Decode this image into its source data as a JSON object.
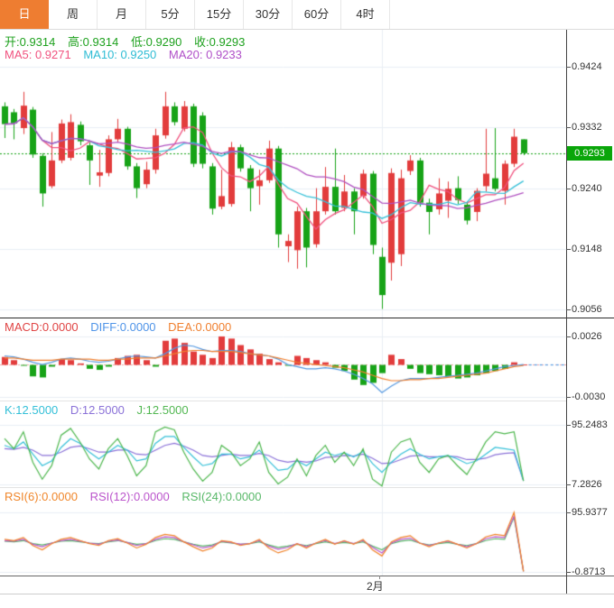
{
  "tabbar": {
    "tabs": [
      {
        "label": "日",
        "selected": true
      },
      {
        "label": "周",
        "selected": false
      },
      {
        "label": "月",
        "selected": false
      },
      {
        "label": "5分",
        "selected": false
      },
      {
        "label": "15分",
        "selected": false
      },
      {
        "label": "30分",
        "selected": false
      },
      {
        "label": "60分",
        "selected": false
      },
      {
        "label": "4时",
        "selected": false
      }
    ]
  },
  "main_panel": {
    "ohlc": {
      "open": "开:0.9314",
      "high": "高:0.9314",
      "low": "低:0.9290",
      "close": "收:0.9293"
    },
    "ma": {
      "ma5": "MA5: 0.9271",
      "ma10": "MA10: 0.9250",
      "ma20": "MA20: 0.9233"
    },
    "price_tag": "0.9293"
  },
  "macd_panel": {
    "macd": "MACD:0.0000",
    "diff": "DIFF:0.0000",
    "dea": "DEA:0.0000"
  },
  "kdj_panel": {
    "k": "K:12.5000",
    "d": "D:12.5000",
    "j": "J:12.5000"
  },
  "rsi_panel": {
    "rsi6": "RSI(6):0.0000",
    "rsi12": "RSI(12):0.0000",
    "rsi24": "RSI(24):0.0000"
  },
  "x_axis": {
    "label": "2月"
  },
  "colors": {
    "tab_selected": "#ee7d31",
    "candle_up": "#e23c3c",
    "candle_down": "#17a317",
    "price_tag": "#0aa60a",
    "grid": "#e9eef4"
  },
  "chart_data": [
    {
      "type": "candlestick",
      "title": "daily candles with MA5/MA10/MA20 overlays",
      "ylim": [
        0.9044,
        0.948
      ],
      "y_ticks": [
        {
          "v": 0.9424,
          "label": "0.9424"
        },
        {
          "v": 0.9332,
          "label": "0.9332"
        },
        {
          "v": 0.924,
          "label": "0.9240"
        },
        {
          "v": 0.9148,
          "label": "0.9148"
        },
        {
          "v": 0.9056,
          "label": "0.9056"
        }
      ],
      "last_price": 0.9293,
      "x_divider_index": 40,
      "up_color": "#e23c3c",
      "down_color": "#17a317",
      "last_price_line_color": "#12a012",
      "ma_overlays": [
        {
          "name": "MA5",
          "period": 5,
          "value": 0.9271,
          "color": "#f0527f"
        },
        {
          "name": "MA10",
          "period": 10,
          "value": 0.925,
          "color": "#35c0d8"
        },
        {
          "name": "MA20",
          "period": 20,
          "value": 0.9233,
          "color": "#b050c0"
        }
      ],
      "open": [
        0.9364,
        0.9355,
        0.9331,
        0.9359,
        0.9289,
        0.9243,
        0.9282,
        0.9286,
        0.9336,
        0.9305,
        0.9259,
        0.9263,
        0.9314,
        0.933,
        0.9273,
        0.9246,
        0.9268,
        0.932,
        0.9364,
        0.933,
        0.9364,
        0.935,
        0.9273,
        0.9212,
        0.9216,
        0.9302,
        0.927,
        0.9243,
        0.9252,
        0.93,
        0.9152,
        0.9146,
        0.9205,
        0.9155,
        0.9205,
        0.9242,
        0.921,
        0.9235,
        0.9228,
        0.9262,
        0.9136,
        0.9127,
        0.914,
        0.9266,
        0.9282,
        0.9218,
        0.9208,
        0.9221,
        0.924,
        0.9215,
        0.9204,
        0.9243,
        0.9255,
        0.9236,
        0.9277,
        0.9314
      ],
      "high": [
        0.937,
        0.936,
        0.9386,
        0.9363,
        0.9293,
        0.9325,
        0.9344,
        0.9352,
        0.9341,
        0.9309,
        0.9298,
        0.932,
        0.9345,
        0.9333,
        0.9278,
        0.928,
        0.933,
        0.9386,
        0.937,
        0.9372,
        0.9368,
        0.9355,
        0.9278,
        0.9268,
        0.931,
        0.9306,
        0.9275,
        0.9268,
        0.9312,
        0.9304,
        0.917,
        0.9212,
        0.921,
        0.924,
        0.9272,
        0.93,
        0.926,
        0.924,
        0.9268,
        0.9266,
        0.915,
        0.927,
        0.9268,
        0.929,
        0.9286,
        0.9224,
        0.9255,
        0.925,
        0.9258,
        0.922,
        0.924,
        0.933,
        0.9331,
        0.9282,
        0.933,
        0.9314
      ],
      "low": [
        0.9316,
        0.9314,
        0.9322,
        0.9286,
        0.9212,
        0.924,
        0.9278,
        0.9282,
        0.9305,
        0.9245,
        0.9242,
        0.9258,
        0.931,
        0.9268,
        0.9225,
        0.924,
        0.9262,
        0.9315,
        0.9335,
        0.9326,
        0.9272,
        0.927,
        0.92,
        0.9208,
        0.9212,
        0.9265,
        0.9205,
        0.9215,
        0.9248,
        0.915,
        0.9128,
        0.9118,
        0.912,
        0.915,
        0.92,
        0.92,
        0.9205,
        0.917,
        0.9224,
        0.914,
        0.9057,
        0.91,
        0.9122,
        0.926,
        0.9212,
        0.917,
        0.92,
        0.9195,
        0.9216,
        0.9185,
        0.919,
        0.9235,
        0.9235,
        0.9215,
        0.9272,
        0.929
      ],
      "close": [
        0.9337,
        0.9338,
        0.9365,
        0.9291,
        0.9232,
        0.9282,
        0.9338,
        0.934,
        0.9311,
        0.9282,
        0.9264,
        0.9314,
        0.933,
        0.9273,
        0.924,
        0.9268,
        0.932,
        0.9364,
        0.934,
        0.9364,
        0.9277,
        0.9277,
        0.9209,
        0.9228,
        0.9302,
        0.927,
        0.924,
        0.9252,
        0.93,
        0.917,
        0.916,
        0.9205,
        0.915,
        0.9205,
        0.9242,
        0.9205,
        0.9235,
        0.9205,
        0.9262,
        0.9154,
        0.9078,
        0.9263,
        0.9255,
        0.9282,
        0.9218,
        0.9204,
        0.9232,
        0.9239,
        0.9222,
        0.9191,
        0.9236,
        0.9262,
        0.9239,
        0.9277,
        0.9318,
        0.9293
      ]
    },
    {
      "type": "bar",
      "title": "MACD",
      "ylim": [
        -0.00334,
        0.00427
      ],
      "y_ticks": [
        {
          "v": 0.0026,
          "label": "0.0026"
        },
        {
          "v": -0.003,
          "label": "-0.0030"
        }
      ],
      "hist_up_color": "#e23c3c",
      "hist_down_color": "#17a317",
      "zero_line_color": "#f0a0a0",
      "hist": [
        0.0007,
        0.0004,
        -0.0001,
        -0.0011,
        -0.0012,
        -0.0002,
        0.0005,
        0.0004,
        0.0001,
        -0.0004,
        -0.0005,
        -0.0002,
        0.0006,
        0.0008,
        0.0009,
        0.0004,
        -0.0002,
        0.0022,
        0.0024,
        0.002,
        0.0012,
        0.0009,
        0.0006,
        0.0026,
        0.0024,
        0.0018,
        0.0014,
        0.001,
        0.0005,
        0.0002,
        -0.0001,
        0.0008,
        0.0006,
        0.0004,
        0.0002,
        -0.0003,
        -0.0006,
        -0.0014,
        -0.0019,
        -0.0017,
        -0.0008,
        0.0009,
        0.0005,
        -0.0004,
        -0.0008,
        -0.0009,
        -0.001,
        -0.0011,
        -0.0013,
        -0.0012,
        -0.001,
        -0.0008,
        -0.0006,
        -0.0004,
        0.0002,
        0.0
      ],
      "series": [
        {
          "name": "DIFF",
          "color": "#5498e0",
          "values": [
            0.0008,
            0.0007,
            0.0005,
            0.0002,
            0.0,
            0.0002,
            0.0005,
            0.0006,
            0.0005,
            0.0003,
            0.0002,
            0.0003,
            0.0005,
            0.0007,
            0.0008,
            0.0007,
            0.0006,
            0.001,
            0.0015,
            0.0018,
            0.0017,
            0.0014,
            0.0012,
            0.0013,
            0.0013,
            0.0012,
            0.001,
            0.0009,
            0.0008,
            0.0005,
            0.0,
            -0.0002,
            -0.0004,
            -0.0004,
            -0.0003,
            -0.0004,
            -0.0006,
            -0.0009,
            -0.0013,
            -0.0018,
            -0.0026,
            -0.002,
            -0.0015,
            -0.0013,
            -0.0013,
            -0.0013,
            -0.0012,
            -0.0011,
            -0.001,
            -0.0009,
            -0.0008,
            -0.0006,
            -0.0004,
            -0.0002,
            -0.0001,
            0.0
          ]
        },
        {
          "name": "DEA",
          "color": "#f07f2e",
          "values": [
            0.0006,
            0.0006,
            0.0005,
            0.0004,
            0.0004,
            0.0004,
            0.0005,
            0.0005,
            0.0005,
            0.0005,
            0.0004,
            0.0004,
            0.0005,
            0.0005,
            0.0006,
            0.0006,
            0.0006,
            0.0008,
            0.001,
            0.0012,
            0.0013,
            0.0013,
            0.0012,
            0.0012,
            0.0012,
            0.0011,
            0.001,
            0.0009,
            0.0008,
            0.0006,
            0.0004,
            0.0002,
            0.0001,
            0.0,
            -0.0001,
            -0.0002,
            -0.0003,
            -0.0005,
            -0.0007,
            -0.001,
            -0.0013,
            -0.0015,
            -0.0015,
            -0.0014,
            -0.0014,
            -0.0013,
            -0.0013,
            -0.0012,
            -0.0011,
            -0.001,
            -0.0009,
            -0.0008,
            -0.0006,
            -0.0004,
            -0.0002,
            -0.0001
          ]
        }
      ]
    },
    {
      "type": "line",
      "title": "KDJ",
      "ylim": [
        3.3,
        129.9
      ],
      "y_ticks": [
        {
          "v": 95.2483,
          "label": "95.2483"
        },
        {
          "v": 7.2826,
          "label": "7.2826"
        }
      ],
      "series": [
        {
          "name": "D",
          "color": "#8b72d8",
          "values": [
            60,
            59,
            62,
            58,
            50,
            50,
            55,
            62,
            64,
            60,
            55,
            55,
            58,
            58,
            52,
            51,
            58,
            65,
            68,
            64,
            58,
            50,
            48,
            50,
            52,
            50,
            50,
            53,
            50,
            43,
            40,
            42,
            40,
            42,
            47,
            48,
            50,
            49,
            52,
            46,
            38,
            39,
            44,
            49,
            50,
            48,
            48,
            49,
            48,
            44,
            44,
            46,
            51,
            53,
            54,
            12.5
          ]
        },
        {
          "name": "K",
          "color": "#35c0d8",
          "values": [
            65,
            60,
            70,
            52,
            35,
            42,
            62,
            75,
            68,
            55,
            45,
            55,
            65,
            58,
            42,
            45,
            68,
            78,
            78,
            62,
            48,
            35,
            38,
            52,
            52,
            45,
            48,
            58,
            42,
            28,
            30,
            42,
            35,
            45,
            55,
            50,
            54,
            48,
            56,
            38,
            25,
            40,
            52,
            60,
            52,
            45,
            48,
            50,
            45,
            38,
            42,
            52,
            62,
            60,
            58,
            12.5
          ]
        },
        {
          "name": "J",
          "color": "#4cb64c",
          "values": [
            75,
            60,
            85,
            40,
            15,
            35,
            80,
            90,
            70,
            45,
            30,
            60,
            75,
            50,
            20,
            35,
            85,
            92,
            88,
            55,
            30,
            12,
            25,
            65,
            55,
            35,
            45,
            70,
            25,
            8,
            18,
            45,
            20,
            50,
            65,
            40,
            55,
            35,
            60,
            15,
            5,
            55,
            70,
            75,
            40,
            25,
            45,
            50,
            35,
            22,
            45,
            70,
            85,
            82,
            85,
            12.5
          ]
        }
      ]
    },
    {
      "type": "line",
      "title": "RSI",
      "ylim": [
        -6.8,
        135.5
      ],
      "y_ticks": [
        {
          "v": 95.9377,
          "label": "95.9377"
        },
        {
          "v": -0.8713,
          "label": "-0.8713"
        }
      ],
      "series": [
        {
          "name": "RSI24",
          "color": "#58b868",
          "values": [
            49,
            48,
            50,
            45,
            43,
            46,
            49,
            50,
            48,
            46,
            45,
            48,
            50,
            47,
            44,
            45,
            50,
            53,
            52,
            48,
            44,
            41,
            43,
            48,
            46,
            44,
            45,
            48,
            43,
            39,
            41,
            44,
            42,
            45,
            48,
            45,
            47,
            45,
            48,
            41,
            35,
            45,
            49,
            51,
            46,
            43,
            45,
            47,
            44,
            42,
            45,
            50,
            53,
            52,
            88,
            0
          ]
        },
        {
          "name": "RSI12",
          "color": "#bb55cc",
          "values": [
            50,
            49,
            52,
            44,
            40,
            46,
            50,
            52,
            49,
            46,
            44,
            49,
            51,
            47,
            42,
            45,
            52,
            56,
            55,
            48,
            43,
            38,
            41,
            49,
            47,
            44,
            45,
            50,
            41,
            36,
            39,
            45,
            40,
            46,
            50,
            45,
            49,
            45,
            50,
            39,
            30,
            46,
            52,
            54,
            46,
            42,
            46,
            49,
            44,
            40,
            45,
            53,
            56,
            55,
            90,
            0
          ]
        },
        {
          "name": "RSI6",
          "color": "#f08228",
          "values": [
            52,
            50,
            55,
            42,
            35,
            45,
            52,
            55,
            50,
            45,
            42,
            50,
            53,
            46,
            38,
            44,
            55,
            60,
            58,
            48,
            40,
            33,
            38,
            50,
            48,
            42,
            45,
            52,
            38,
            30,
            35,
            45,
            38,
            46,
            52,
            44,
            50,
            44,
            52,
            35,
            25,
            48,
            55,
            58,
            46,
            40,
            46,
            50,
            44,
            38,
            45,
            56,
            60,
            58,
            96,
            0
          ]
        }
      ]
    }
  ]
}
